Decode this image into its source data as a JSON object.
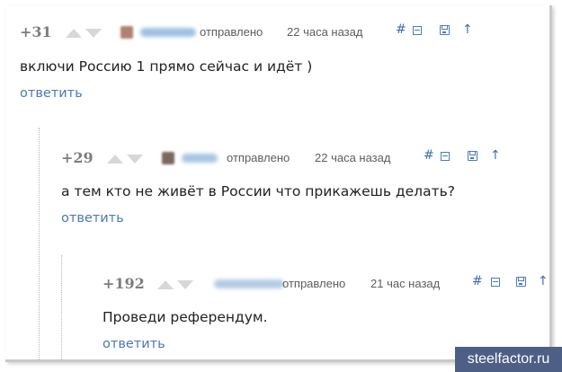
{
  "comments": [
    {
      "score": "+31",
      "sent_label": "отправлено",
      "time": "22 часа назад",
      "text": "включи Россию 1 прямо сейчас и идёт )",
      "reply_label": "ответить",
      "actions": {
        "link": "#",
        "collapse": "⊟",
        "save": "save",
        "parent": "↑"
      }
    },
    {
      "score": "+29",
      "sent_label": "отправлено",
      "time": "22 часа назад",
      "text": "а тем кто не живёт в России что прикажешь делать?",
      "reply_label": "ответить",
      "actions": {
        "link": "#",
        "collapse": "⊟",
        "save": "save",
        "parent": "↑"
      }
    },
    {
      "score": "+192",
      "sent_label": "отправлено",
      "time": "21 час назад",
      "text": "Проведи референдум.",
      "reply_label": "ответить",
      "actions": {
        "link": "#",
        "collapse": "⊟",
        "save": "save",
        "parent": "↑"
      }
    }
  ],
  "watermark": "steelfactor.ru",
  "colors": {
    "score": "#7d7d7d",
    "vote_arrow": "#d7d7d7",
    "link_blue": "#4a78b8",
    "meta_text": "#5d5d5d",
    "body_text": "#222222",
    "watermark_bg": "#4d5f84"
  }
}
